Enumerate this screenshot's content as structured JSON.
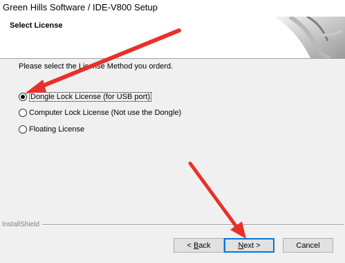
{
  "window": {
    "title": "Green Hills Software / IDE-V800 Setup"
  },
  "header": {
    "heading": "Select License"
  },
  "prompt": "Please select the License Method you orderd.",
  "options": [
    {
      "label": "Dongle Lock License (for USB port)",
      "checked": true
    },
    {
      "label": "Computer Lock License (Not use the Dongle)",
      "checked": false
    },
    {
      "label": "Floating License",
      "checked": false
    }
  ],
  "footer": {
    "brand": "InstallShield"
  },
  "buttons": {
    "back_mnemonic": "B",
    "back_rest": "ack",
    "next_mnemonic": "N",
    "next_rest": "ext",
    "cancel": "Cancel",
    "back_prefix": "< ",
    "next_suffix": " >"
  },
  "annotations": {
    "arrow_color": "#e8302a"
  }
}
